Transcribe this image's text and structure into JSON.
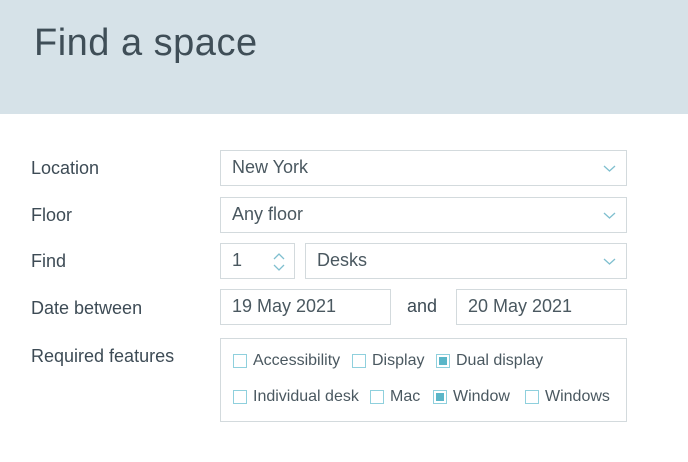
{
  "header": {
    "title": "Find a space"
  },
  "form": {
    "location": {
      "label": "Location",
      "value": "New York"
    },
    "floor": {
      "label": "Floor",
      "value": "Any floor"
    },
    "find": {
      "label": "Find",
      "quantity": "1",
      "type": "Desks"
    },
    "dates": {
      "label": "Date between",
      "from": "19 May 2021",
      "and_label": "and",
      "to": "20 May 2021"
    },
    "features": {
      "label": "Required features",
      "items": [
        {
          "label": "Accessibility",
          "checked": false
        },
        {
          "label": "Display",
          "checked": false
        },
        {
          "label": "Dual display",
          "checked": true
        },
        {
          "label": "Individual desk",
          "checked": false
        },
        {
          "label": "Mac",
          "checked": false
        },
        {
          "label": "Window",
          "checked": true
        },
        {
          "label": "Windows",
          "checked": false
        }
      ]
    }
  },
  "colors": {
    "header_bg": "#d6e2e8",
    "checkbox_accent": "#5ab6c8",
    "border": "#d3dadd"
  }
}
